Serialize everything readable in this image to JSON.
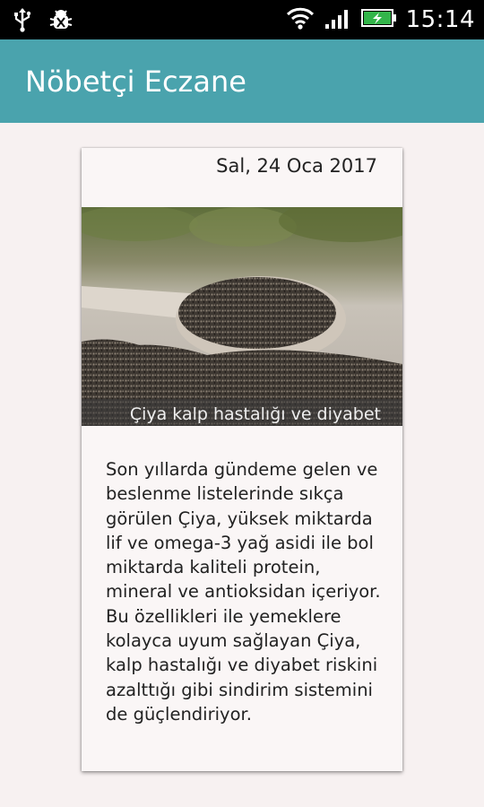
{
  "status_bar": {
    "time": "15:14",
    "icons": [
      "usb-icon",
      "debug-icon",
      "wifi-icon",
      "signal-icon",
      "battery-charging-icon"
    ]
  },
  "app_bar": {
    "title": "Nöbetçi Eczane",
    "background": "#4aa3ad"
  },
  "card": {
    "date": "Sal, 24 Oca 2017",
    "image_caption": "Çiya kalp hastalığı ve diyabet",
    "body": "Son yıllarda gündeme gelen ve beslenme listelerinde sıkça görülen Çiya, yüksek miktarda lif ve omega-3 yağ asidi ile bol miktarda kaliteli protein, mineral ve antioksidan içeriyor. Bu özellikleri ile yemeklere kolayca uyum sağlayan Çiya, kalp hastalığı ve diyabet riskini azalttığı gibi sindirim sistemini de güçlendiriyor."
  }
}
